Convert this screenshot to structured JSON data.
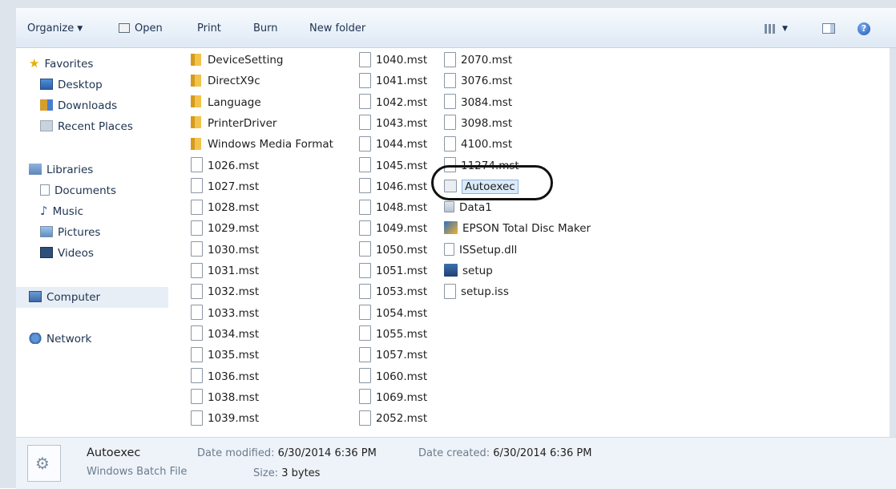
{
  "toolbar": {
    "organize": "Organize",
    "open": "Open",
    "print": "Print",
    "burn": "Burn",
    "new_folder": "New folder"
  },
  "nav": {
    "favorites": "Favorites",
    "desktop": "Desktop",
    "downloads": "Downloads",
    "recent_places": "Recent Places",
    "libraries": "Libraries",
    "documents": "Documents",
    "music": "Music",
    "pictures": "Pictures",
    "videos": "Videos",
    "computer": "Computer",
    "network": "Network"
  },
  "files": {
    "col1": [
      "DeviceSetting",
      "DirectX9c",
      "Language",
      "PrinterDriver",
      "Windows Media Format",
      "1026.mst",
      "1027.mst",
      "1028.mst",
      "1029.mst",
      "1030.mst",
      "1031.mst",
      "1032.mst",
      "1033.mst",
      "1034.mst",
      "1035.mst",
      "1036.mst",
      "1038.mst",
      "1039.mst"
    ],
    "col2": [
      "1040.mst",
      "1041.mst",
      "1042.mst",
      "1043.mst",
      "1044.mst",
      "1045.mst",
      "1046.mst",
      "1048.mst",
      "1049.mst",
      "1050.mst",
      "1051.mst",
      "1053.mst",
      "1054.mst",
      "1055.mst",
      "1057.mst",
      "1060.mst",
      "1069.mst",
      "2052.mst"
    ],
    "col3": [
      "2070.mst",
      "3076.mst",
      "3084.mst",
      "3098.mst",
      "4100.mst",
      "11274.mst",
      "Autoexec",
      "Data1",
      "EPSON Total Disc Maker",
      "ISSetup.dll",
      "setup",
      "setup.iss"
    ]
  },
  "details": {
    "name": "Autoexec",
    "type": "Windows Batch File",
    "modified_label": "Date modified:",
    "modified_value": "6/30/2014 6:36 PM",
    "created_label": "Date created:",
    "created_value": "6/30/2014 6:36 PM",
    "size_label": "Size:",
    "size_value": "3 bytes"
  },
  "colors": {
    "selection": "#dbeaf9",
    "toolbar_text": "#1e3250",
    "highlight_ring": "#111111"
  }
}
